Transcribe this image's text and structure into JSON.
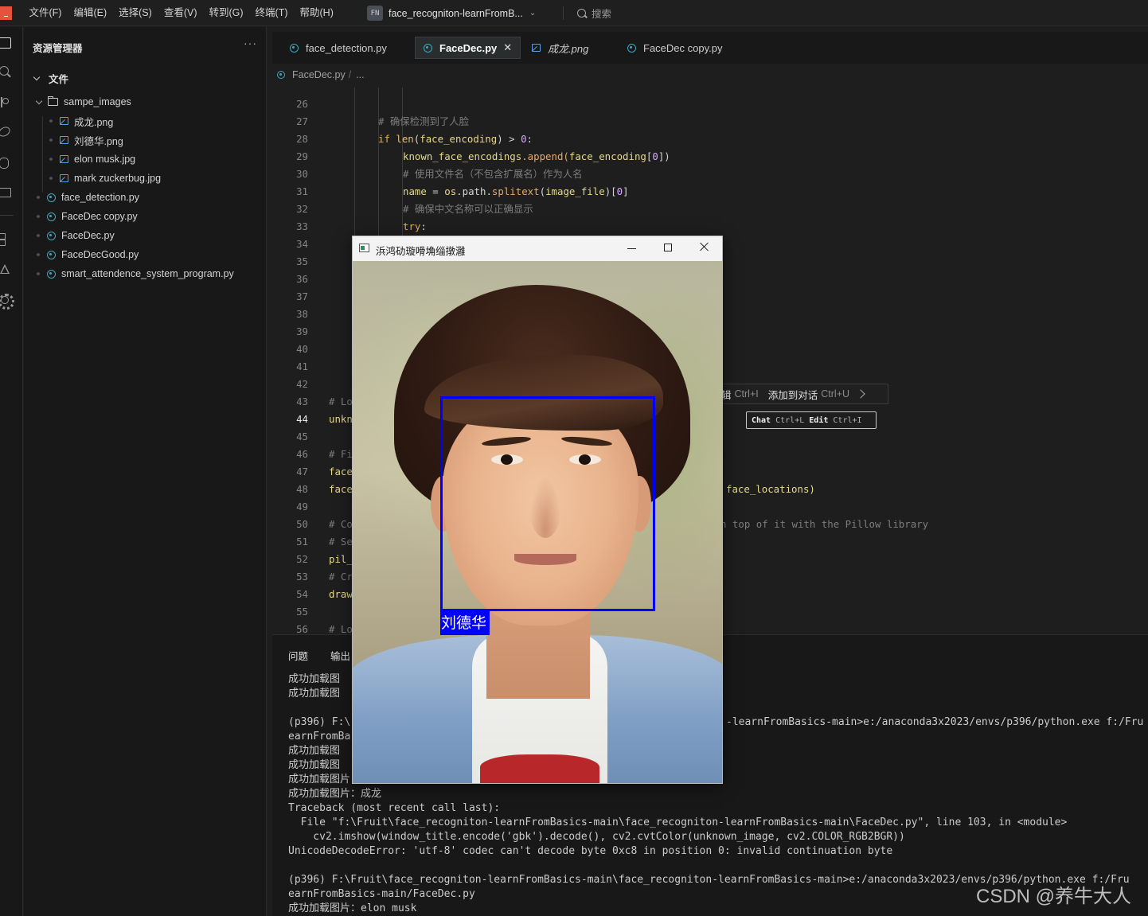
{
  "app": {
    "logo_icon": "app-logo-icon"
  },
  "menu": [
    "文件(F)",
    "编辑(E)",
    "选择(S)",
    "查看(V)",
    "转到(G)",
    "终端(T)",
    "帮助(H)"
  ],
  "project": {
    "badge": "FN",
    "name": "face_recogniton-learnFromB..."
  },
  "search": {
    "label": "搜索"
  },
  "activity_icons": [
    "files-icon",
    "search-icon",
    "source-control-icon",
    "remote-icon",
    "debug-icon",
    "monitor-icon",
    "extensions-icon",
    "flask-icon",
    "settings-icon"
  ],
  "explorer": {
    "title": "资源管理器",
    "more": "···",
    "section": "文件",
    "folder": "sampe_images",
    "images": [
      "成龙.png",
      "刘德华.png",
      "elon musk.jpg",
      "mark zuckerbug.jpg"
    ],
    "files": [
      "face_detection.py",
      "FaceDec copy.py",
      "FaceDec.py",
      "FaceDecGood.py",
      "smart_attendence_system_program.py"
    ]
  },
  "tabs": [
    {
      "label": "face_detection.py",
      "type": "py"
    },
    {
      "label": "FaceDec.py",
      "type": "py",
      "active": true
    },
    {
      "label": "成龙.png",
      "type": "image"
    },
    {
      "label": "FaceDec copy.py",
      "type": "py"
    }
  ],
  "tab_close": "✕",
  "breadcrumb": {
    "file": "FaceDec.py",
    "sep": "/",
    "more": "..."
  },
  "code": {
    "line_numbers": [
      "26",
      "27",
      "28",
      "29",
      "30",
      "31",
      "32",
      "33",
      "34",
      "35",
      "36",
      "37",
      "38",
      "39",
      "40",
      "41",
      "42",
      "43",
      "44",
      "45",
      "46",
      "47",
      "48",
      "49",
      "50",
      "51",
      "52",
      "53",
      "54",
      "55",
      "56"
    ],
    "l27": "# 确保检测到了人脸",
    "l28_kw": "if",
    "l28_fn": "len",
    "l28_a": "(",
    "l28_p": "face_encoding",
    "l28_b": ") > ",
    "l28_n": "0",
    "l28_c": ":",
    "l29_a": "known_face_encodings",
    "l29_m": ".append(",
    "l29_p": "face_encoding",
    "l29_b": "[",
    "l29_n": "0",
    "l29_c": "])",
    "l30": "# 使用文件名（不包含扩展名）作为人名",
    "l31_a": "name",
    "l31_b": " = ",
    "l31_c": "os",
    "l31_d": ".path.",
    "l31_m": "splitext",
    "l31_e": "(",
    "l31_p": "image_file",
    "l31_f": ")[",
    "l31_n": "0",
    "l31_g": "]",
    "l32": "# 确保中文名称可以正确显示",
    "l33_kw": "try",
    "l33_c": ":",
    "l43": "# Lo",
    "l44": "unkn",
    "l46": "# Fi",
    "l47": "face",
    "l48": "face",
    "l48_tail": "face_locations)",
    "l50": "# Co",
    "l50_tail": "n top of it with the Pillow library",
    "l51": "# Se",
    "l52": "pil_",
    "l53": "# Cr",
    "l54": "draw",
    "l56": "# Lo"
  },
  "hint": {
    "edit_label": "辑",
    "edit_key": "Ctrl+I",
    "add_label": "添加到对话",
    "add_key": "Ctrl+U"
  },
  "chat_hint": {
    "chat": "Chat",
    "chat_key": "Ctrl+L",
    "edit": "Edit",
    "edit_key": "Ctrl+I"
  },
  "panel": {
    "tabs": [
      "问题",
      "输出"
    ],
    "lines": [
      "成功加载图",
      "成功加载图",
      "",
      "(p396) F:\\",
      "earnFromBa",
      "成功加载图",
      "成功加载图",
      "成功加载图片：刘德",
      "成功加载图片：成龙",
      "Traceback (most recent call last):",
      "  File \"f:\\Fruit\\face_recogniton-learnFromBasics-main\\face_recogniton-learnFromBasics-main\\FaceDec.py\", line 103, in <module>",
      "    cv2.imshow(window_title.encode('gbk').decode(), cv2.cvtColor(unknown_image, cv2.COLOR_RGB2BGR))",
      "UnicodeDecodeError: 'utf-8' codec can't decode byte 0xc8 in position 0: invalid continuation byte",
      "",
      "(p396) F:\\Fruit\\face_recogniton-learnFromBasics-main\\face_recogniton-learnFromBasics-main>e:/anaconda3x2023/envs/p396/python.exe f:/Fru",
      "earnFromBasics-main/FaceDec.py",
      "成功加载图片：elon musk"
    ],
    "line4_tail": "-learnFromBasics-main>e:/anaconda3x2023/envs/p396/python.exe f:/Fru"
  },
  "image_window": {
    "title": "浜鸿劯璇嗗埆缁撴灉",
    "face_label": "刘德华",
    "box_color": "#0000ff"
  },
  "watermark": "CSDN @养牛大人"
}
